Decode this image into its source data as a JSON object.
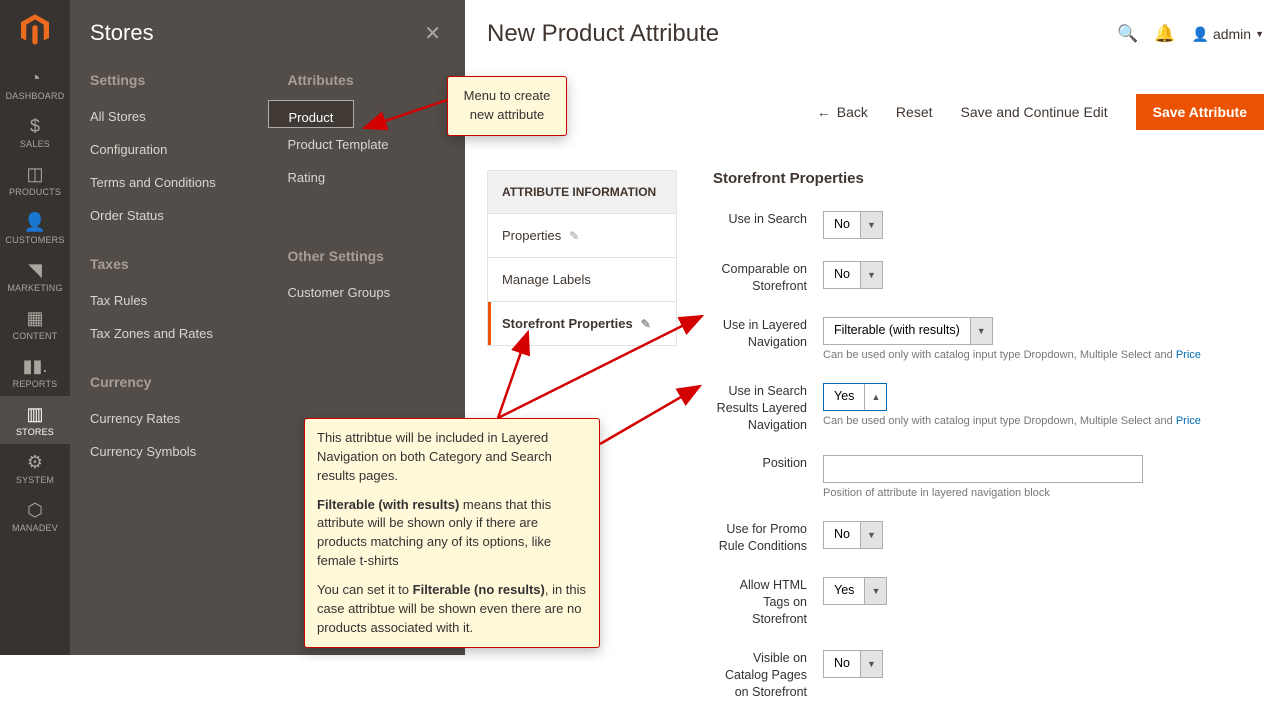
{
  "rail": {
    "items": [
      {
        "icon": "◐",
        "label": "DASHBOARD"
      },
      {
        "icon": "$",
        "label": "SALES"
      },
      {
        "icon": "◍",
        "label": "PRODUCTS"
      },
      {
        "icon": "◉",
        "label": "CUSTOMERS"
      },
      {
        "icon": "📢",
        "label": "MARKETING"
      },
      {
        "icon": "▦",
        "label": "CONTENT"
      },
      {
        "icon": "▮▮.",
        "label": "REPORTS"
      },
      {
        "icon": "🏬",
        "label": "STORES"
      },
      {
        "icon": "⚙",
        "label": "SYSTEM"
      },
      {
        "icon": "⬡",
        "label": "MANADEV"
      }
    ]
  },
  "flyout": {
    "title": "Stores",
    "col1": [
      {
        "group": "Settings",
        "links": [
          "All Stores",
          "Configuration",
          "Terms and Conditions",
          "Order Status"
        ]
      },
      {
        "group": "Taxes",
        "links": [
          "Tax Rules",
          "Tax Zones and Rates"
        ]
      },
      {
        "group": "Currency",
        "links": [
          "Currency Rates",
          "Currency Symbols"
        ]
      }
    ],
    "col2": [
      {
        "group": "Attributes",
        "links": [
          "Product",
          "Product Template",
          "Rating"
        ]
      },
      {
        "group": "Other Settings",
        "links": [
          "Customer Groups"
        ]
      }
    ]
  },
  "page": {
    "title": "New Product Attribute",
    "user": "admin",
    "actions": {
      "back": "Back",
      "reset": "Reset",
      "save_continue": "Save and Continue Edit",
      "save": "Save Attribute"
    }
  },
  "attr_info": {
    "header": "ATTRIBUTE INFORMATION",
    "tabs": [
      "Properties",
      "Manage Labels",
      "Storefront Properties"
    ]
  },
  "storefront": {
    "heading": "Storefront Properties",
    "fields": {
      "use_in_search": {
        "label": "Use in Search",
        "value": "No"
      },
      "comparable": {
        "label": "Comparable on Storefront",
        "value": "No"
      },
      "layered_nav": {
        "label": "Use in Layered Navigation",
        "value": "Filterable (with results)",
        "help_pre": "Can be used only with catalog input type Dropdown, Multiple Select and ",
        "help_link": "Price"
      },
      "search_layered": {
        "label": "Use in Search Results Layered Navigation",
        "value": "Yes",
        "help_pre": "Can be used only with catalog input type Dropdown, Multiple Select and ",
        "help_link": "Price"
      },
      "position": {
        "label": "Position",
        "value": "",
        "help": "Position of attribute in layered navigation block"
      },
      "promo": {
        "label": "Use for Promo Rule Conditions",
        "value": "No"
      },
      "html_tags": {
        "label": "Allow HTML Tags on Storefront",
        "value": "Yes"
      },
      "visible_catalog": {
        "label": "Visible on Catalog Pages on Storefront",
        "value": "No"
      }
    }
  },
  "callouts": {
    "small": "Menu to create new attribute",
    "big": {
      "p1": "This attribtue will be included in Layered Navigation on both Category and Search results pages.",
      "p2a": "Filterable (with results)",
      "p2b": " means that this attribute will be shown only if there are products matching any of its options, like female t-shirts",
      "p3a": "You can set it to ",
      "p3b": "Filterable (no results)",
      "p3c": ", in this case attribtue will be shown even there are no products associated with it."
    }
  }
}
